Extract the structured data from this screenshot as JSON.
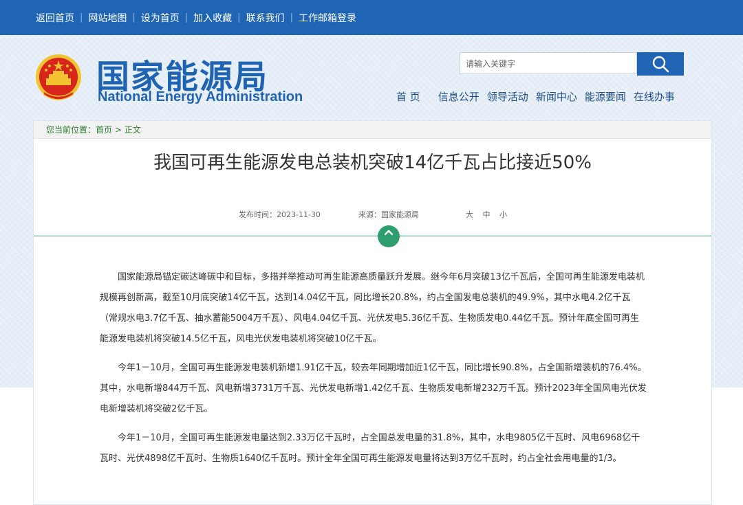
{
  "topbar": {
    "links": [
      "返回首页",
      "网站地图",
      "设为首页",
      "加入收藏",
      "联系我们",
      "工作邮箱登录"
    ],
    "separator": "|"
  },
  "brand": {
    "name_cn": "国家能源局",
    "name_en": "National Energy Administration"
  },
  "search": {
    "placeholder": "请输入关键字"
  },
  "nav": {
    "items": [
      "首 页",
      "信息公开",
      "领导活动",
      "新闻中心",
      "能源要闻",
      "在线办事"
    ]
  },
  "breadcrumb": {
    "prefix": "您当前位置：",
    "home": "首页",
    "sep": ">",
    "current": "正文"
  },
  "article": {
    "title": "我国可再生能源发电总装机突破14亿千瓦占比接近50%",
    "publish": "发布时间：2023-11-30",
    "source": "来源：国家能源局",
    "font_sizes": [
      "大",
      "中",
      "小"
    ],
    "paragraphs": [
      "国家能源局锚定碳达峰碳中和目标，多措并举推动可再生能源高质量跃升发展。继今年6月突破13亿千瓦后，全国可再生能源发电装机规模再创新高，截至10月底突破14亿千瓦，达到14.04亿千瓦，同比增长20.8%，约占全国发电总装机的49.9%，其中水电4.2亿千瓦（常规水电3.7亿千瓦、抽水蓄能5004万千瓦）、风电4.04亿千瓦、光伏发电5.36亿千瓦、生物质发电0.44亿千瓦。预计年底全国可再生能源发电装机将突破14.5亿千瓦，风电光伏发电装机将突破10亿千瓦。",
      "今年1－10月，全国可再生能源发电装机新增1.91亿千瓦，较去年同期增加近1亿千瓦，同比增长90.8%，占全国新增装机的76.4%。其中，水电新增844万千瓦、风电新增3731万千瓦、光伏发电新增1.42亿千瓦、生物质发电新增232万千瓦。预计2023年全国风电光伏发电新增装机将突破2亿千瓦。",
      "今年1－10月，全国可再生能源发电量达到2.33万亿千瓦时，占全国总发电量的31.8%，其中，水电9805亿千瓦时、风电6968亿千瓦时、光伏4898亿千瓦时、生物质1640亿千瓦时。预计全年全国可再生能源发电量将达到3万亿千瓦时，约占全社会用电量的1/3。"
    ]
  },
  "colors": {
    "primary": "#1f65b4",
    "accent_green": "#2f9e6e",
    "emblem_red": "#d8261c",
    "emblem_gold": "#f3c230"
  }
}
